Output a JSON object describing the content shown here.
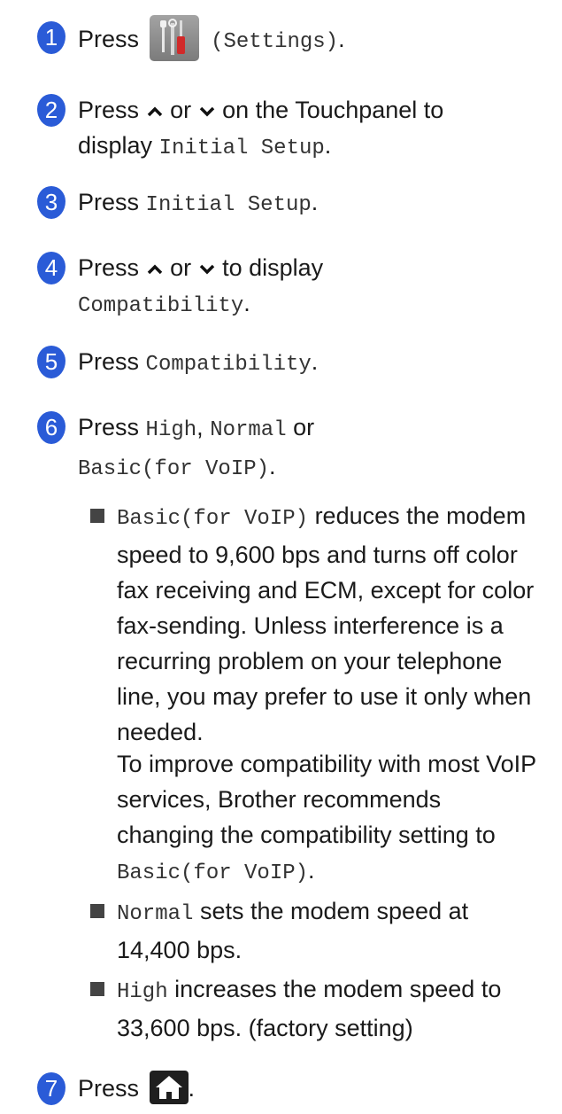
{
  "steps": [
    {
      "num": "1",
      "press": "Press",
      "settings": "(Settings)",
      "tail": "."
    },
    {
      "num": "2",
      "press": "Press",
      "or": "or",
      "tail1": "on the Touchpanel to",
      "display": "display",
      "mono": "Initial Setup",
      "tail2": "."
    },
    {
      "num": "3",
      "press": "Press",
      "mono": "Initial Setup",
      "tail": "."
    },
    {
      "num": "4",
      "press": "Press",
      "or": "or",
      "tail1": "to display",
      "mono": "Compatibility",
      "tail2": "."
    },
    {
      "num": "5",
      "press": "Press",
      "mono": "Compatibility",
      "tail": "."
    },
    {
      "num": "6",
      "press": "Press",
      "mono1": "High",
      "comma": ",",
      "mono2": "Normal",
      "or": "or",
      "mono3": "Basic(for VoIP)",
      "tail": "."
    },
    {
      "num": "7",
      "press": "Press",
      "tail": "."
    }
  ],
  "bullets": [
    {
      "mono": "Basic(for VoIP)",
      "text": "reduces the modem speed to 9,600 bps and turns off color fax receiving and ECM, except for color fax-sending. Unless interference is a recurring problem on your telephone line, you may prefer to use it only when needed."
    },
    {
      "para": "To improve compatibility with most VoIP services, Brother recommends changing the compatibility setting to",
      "mono": "Basic(for VoIP)",
      "tail": "."
    },
    {
      "mono": "Normal",
      "text": "sets the modem speed at 14,400 bps."
    },
    {
      "mono": "High",
      "text": "increases the modem speed to 33,600 bps. (factory setting)"
    }
  ],
  "icons": {
    "settings": "settings-tools-icon",
    "home": "home-icon",
    "up": "chevron-up-icon",
    "down": "chevron-down-icon"
  },
  "colors": {
    "step_badge": "#2a5bd7",
    "settings_button": "#8f8f8f",
    "home_button": "#1f1f1f"
  }
}
